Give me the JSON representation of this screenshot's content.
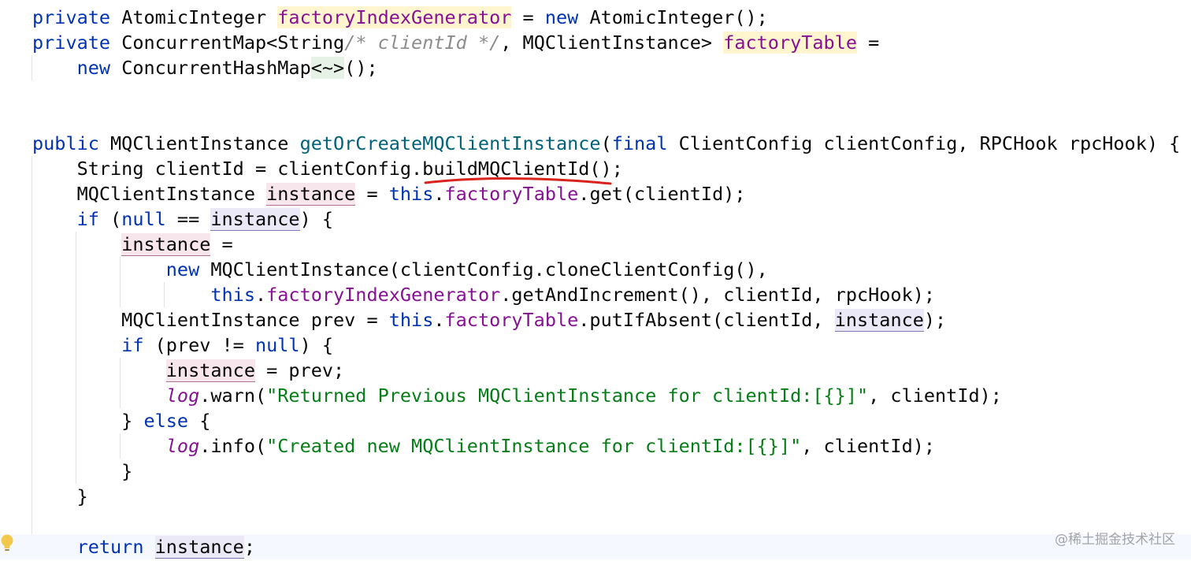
{
  "editor": {
    "lines": [
      {
        "row": 0,
        "segments": [
          {
            "t": "private",
            "c": "kw"
          },
          {
            "t": " AtomicInteger "
          },
          {
            "t": "factoryIndexGenerator",
            "c": "fld hl-yellow"
          },
          {
            "t": " = "
          },
          {
            "t": "new",
            "c": "kw"
          },
          {
            "t": " AtomicInteger();"
          }
        ]
      },
      {
        "row": 1,
        "segments": [
          {
            "t": "private",
            "c": "kw"
          },
          {
            "t": " ConcurrentMap<String"
          },
          {
            "t": "/* clientId */",
            "c": "cmt"
          },
          {
            "t": ", MQClientInstance> "
          },
          {
            "t": "factoryTable",
            "c": "fld hl-yellow"
          },
          {
            "t": " ="
          }
        ]
      },
      {
        "row": 2,
        "segments": [
          {
            "t": "    "
          },
          {
            "t": "new",
            "c": "kw"
          },
          {
            "t": " ConcurrentHashMap"
          },
          {
            "t": "<~>",
            "c": "hl-green"
          },
          {
            "t": "();"
          }
        ]
      },
      {
        "row": 3,
        "segments": []
      },
      {
        "row": 4,
        "segments": []
      },
      {
        "row": 5,
        "segments": [
          {
            "t": "public",
            "c": "kw"
          },
          {
            "t": " MQClientInstance "
          },
          {
            "t": "getOrCreateMQClientInstance",
            "c": "fn"
          },
          {
            "t": "("
          },
          {
            "t": "final",
            "c": "kw"
          },
          {
            "t": " ClientConfig clientConfig, RPCHook rpcHook) {"
          }
        ]
      },
      {
        "row": 6,
        "segments": [
          {
            "t": "    String clientId = clientConfig.buildMQClientId();"
          }
        ]
      },
      {
        "row": 7,
        "segments": [
          {
            "t": "    MQClientInstance "
          },
          {
            "t": "instance",
            "c": "write-var"
          },
          {
            "t": " = "
          },
          {
            "t": "this",
            "c": "kw"
          },
          {
            "t": "."
          },
          {
            "t": "factoryTable",
            "c": "fld"
          },
          {
            "t": ".get(clientId);"
          }
        ]
      },
      {
        "row": 8,
        "segments": [
          {
            "t": "    "
          },
          {
            "t": "if",
            "c": "kw"
          },
          {
            "t": " ("
          },
          {
            "t": "null",
            "c": "kw"
          },
          {
            "t": " == "
          },
          {
            "t": "instance",
            "c": "read-var"
          },
          {
            "t": ") {"
          }
        ]
      },
      {
        "row": 9,
        "segments": [
          {
            "t": "        "
          },
          {
            "t": "instance",
            "c": "write-var"
          },
          {
            "t": " ="
          }
        ]
      },
      {
        "row": 10,
        "segments": [
          {
            "t": "            "
          },
          {
            "t": "new",
            "c": "kw"
          },
          {
            "t": " MQClientInstance(clientConfig.cloneClientConfig(),"
          }
        ]
      },
      {
        "row": 11,
        "segments": [
          {
            "t": "                "
          },
          {
            "t": "this",
            "c": "kw"
          },
          {
            "t": "."
          },
          {
            "t": "factoryIndexGenerator",
            "c": "fld"
          },
          {
            "t": ".getAndIncrement(), clientId, rpcHook);"
          }
        ]
      },
      {
        "row": 12,
        "segments": [
          {
            "t": "        MQClientInstance prev = "
          },
          {
            "t": "this",
            "c": "kw"
          },
          {
            "t": "."
          },
          {
            "t": "factoryTable",
            "c": "fld"
          },
          {
            "t": ".putIfAbsent(clientId, "
          },
          {
            "t": "instance",
            "c": "read-var"
          },
          {
            "t": ");"
          }
        ]
      },
      {
        "row": 13,
        "segments": [
          {
            "t": "        "
          },
          {
            "t": "if",
            "c": "kw"
          },
          {
            "t": " (prev != "
          },
          {
            "t": "null",
            "c": "kw"
          },
          {
            "t": ") {"
          }
        ]
      },
      {
        "row": 14,
        "segments": [
          {
            "t": "            "
          },
          {
            "t": "instance",
            "c": "write-var"
          },
          {
            "t": " = prev;"
          }
        ]
      },
      {
        "row": 15,
        "segments": [
          {
            "t": "            "
          },
          {
            "t": "log",
            "c": "static"
          },
          {
            "t": ".warn("
          },
          {
            "t": "\"Returned Previous MQClientInstance for clientId:[{}]\"",
            "c": "str"
          },
          {
            "t": ", clientId);"
          }
        ]
      },
      {
        "row": 16,
        "segments": [
          {
            "t": "        } "
          },
          {
            "t": "else",
            "c": "kw"
          },
          {
            "t": " {"
          }
        ]
      },
      {
        "row": 17,
        "segments": [
          {
            "t": "            "
          },
          {
            "t": "log",
            "c": "static"
          },
          {
            "t": ".info("
          },
          {
            "t": "\"Created new MQClientInstance for clientId:[{}]\"",
            "c": "str"
          },
          {
            "t": ", clientId);"
          }
        ]
      },
      {
        "row": 18,
        "segments": [
          {
            "t": "        }"
          }
        ]
      },
      {
        "row": 19,
        "segments": [
          {
            "t": "    }"
          }
        ]
      },
      {
        "row": 20,
        "segments": []
      },
      {
        "row": 21,
        "current": true,
        "segments": [
          {
            "t": "    "
          },
          {
            "t": "return",
            "c": "kw"
          },
          {
            "t": " "
          },
          {
            "t": "instance",
            "c": "read-var"
          },
          {
            "t": ";"
          }
        ]
      }
    ]
  },
  "annotation": {
    "target": "buildMQClientId()",
    "color": "#d9231c"
  },
  "gutter": {
    "icon": "lightbulb-icon"
  },
  "watermark": {
    "text": "@稀土掘金技术社区"
  },
  "colors": {
    "keyword": "#0033b3",
    "field": "#871094",
    "method": "#00627a",
    "string": "#067d17",
    "comment": "#8c8c8c",
    "annotation": "#d9231c"
  }
}
